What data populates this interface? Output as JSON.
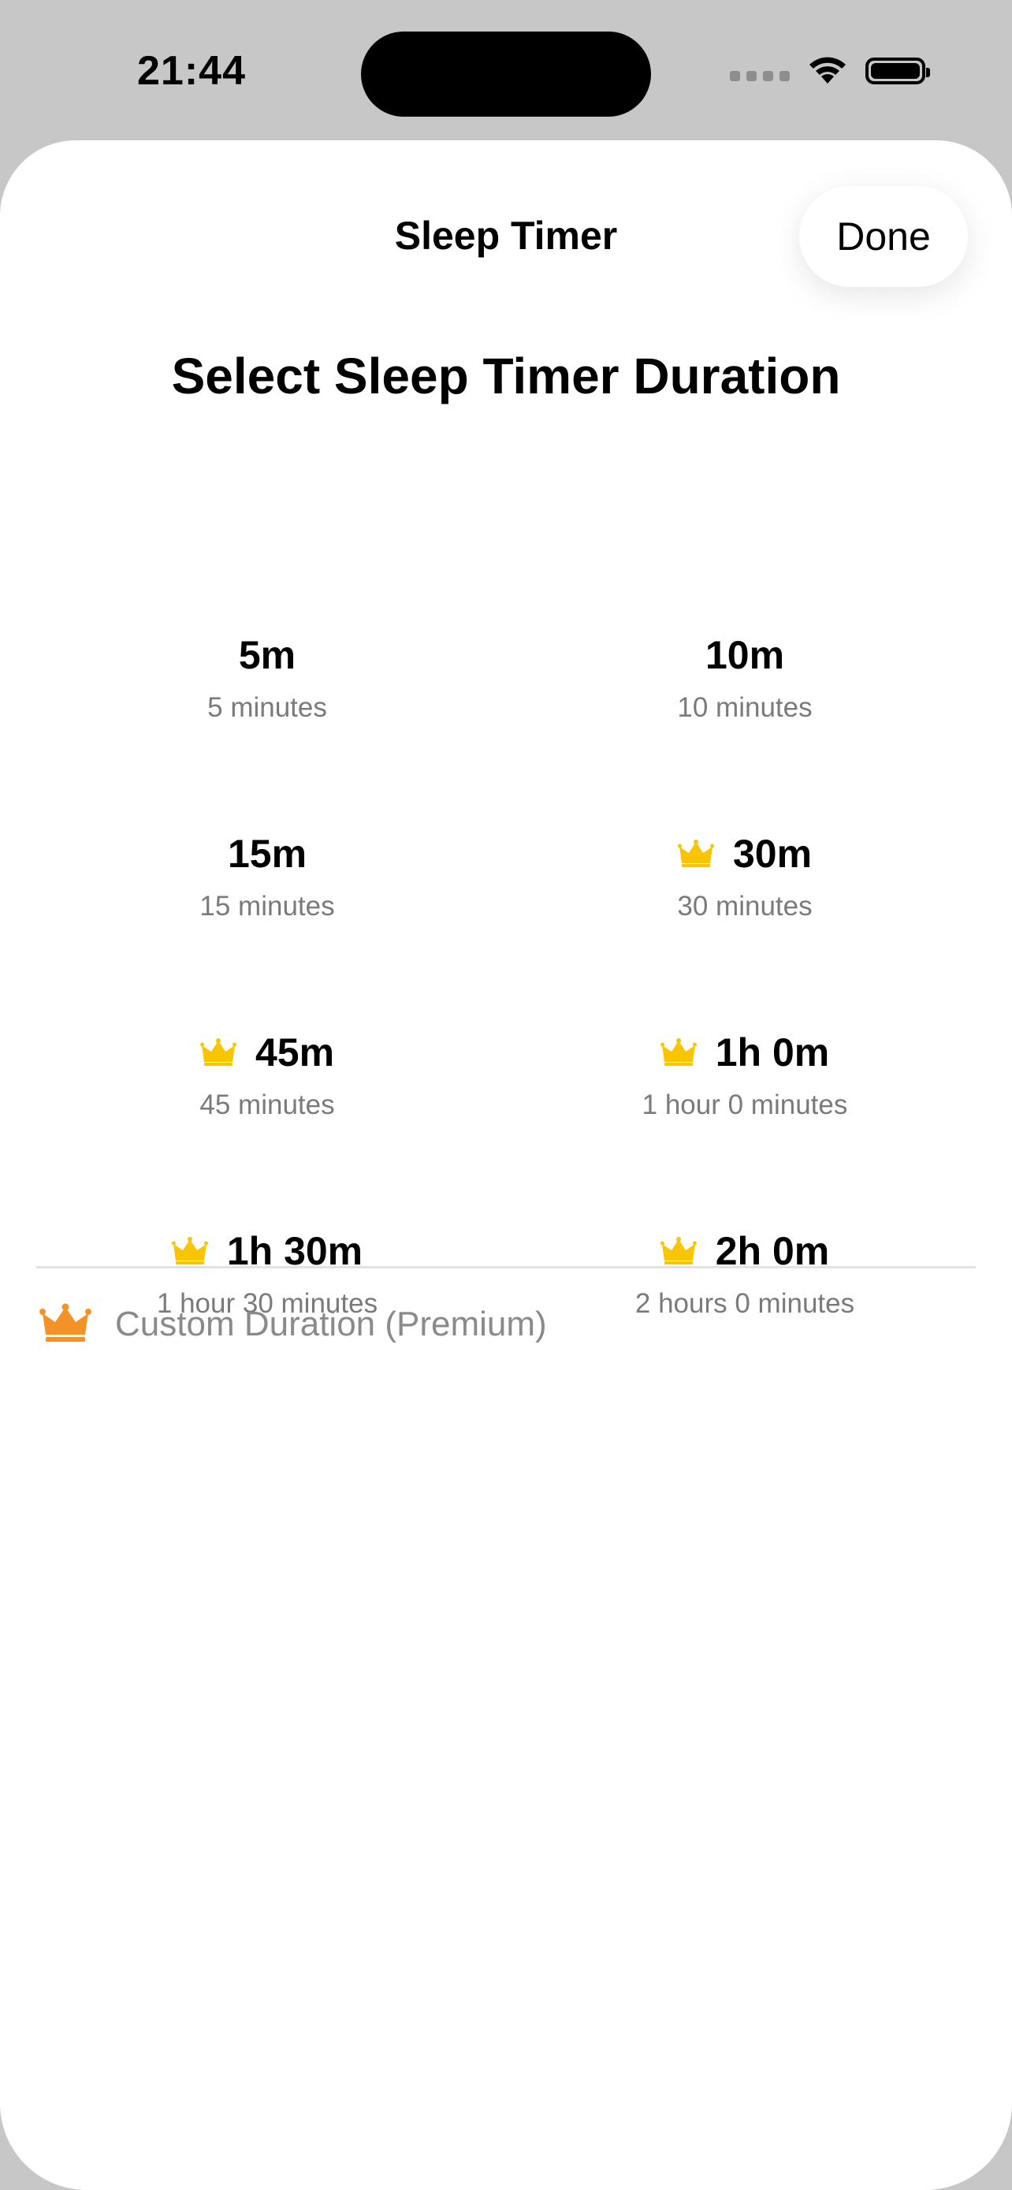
{
  "status_bar": {
    "time": "21:44"
  },
  "sheet": {
    "title": "Sleep Timer",
    "done_label": "Done",
    "heading": "Select Sleep Timer Duration"
  },
  "colors": {
    "crown_yellow": "#F9C400",
    "crown_orange": "#F39327",
    "secondary_text": "#7A7A7A"
  },
  "options": [
    {
      "label": "5m",
      "description": "5 minutes",
      "premium": false
    },
    {
      "label": "10m",
      "description": "10 minutes",
      "premium": false
    },
    {
      "label": "15m",
      "description": "15 minutes",
      "premium": false
    },
    {
      "label": "30m",
      "description": "30 minutes",
      "premium": true
    },
    {
      "label": "45m",
      "description": "45 minutes",
      "premium": true
    },
    {
      "label": "1h 0m",
      "description": "1 hour 0 minutes",
      "premium": true
    },
    {
      "label": "1h 30m",
      "description": "1 hour 30 minutes",
      "premium": true
    },
    {
      "label": "2h 0m",
      "description": "2 hours 0 minutes",
      "premium": true
    }
  ],
  "custom": {
    "label": "Custom Duration (Premium)",
    "icon": "crown-icon"
  }
}
